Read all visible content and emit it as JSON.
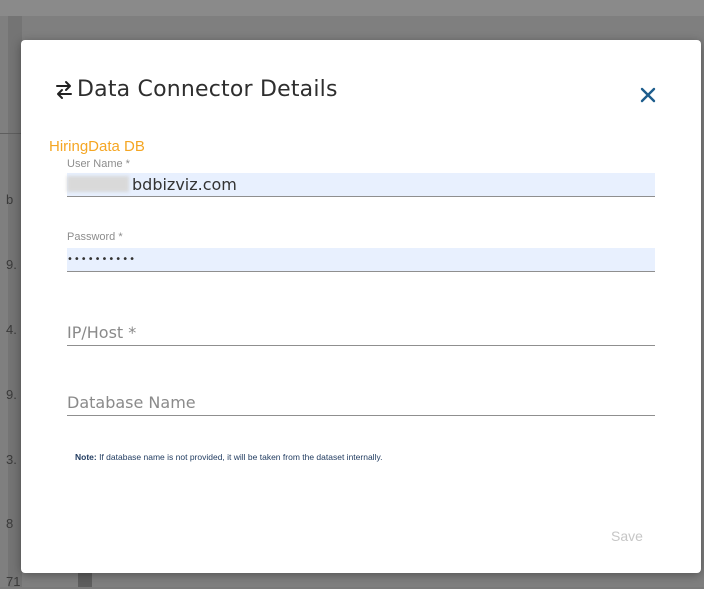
{
  "background": {
    "row_marks": [
      "b",
      "9.",
      "4.",
      "9.",
      "3.",
      "8",
      "71"
    ]
  },
  "modal": {
    "title": "Data Connector Details",
    "header_icon": "swap-arrows-icon",
    "close_icon": "close-icon",
    "section_label": "HiringData DB",
    "fields": {
      "username": {
        "label": "User Name *",
        "value": "bdbizviz.com"
      },
      "password": {
        "label": "Password *",
        "value": "••••••••••"
      },
      "host": {
        "placeholder": "IP/Host *",
        "value": ""
      },
      "database": {
        "placeholder": "Database Name",
        "value": ""
      }
    },
    "note_prefix": "Note:",
    "note_text": " If database name is not provided, it will be taken from the dataset internally.",
    "save_label": "Save"
  },
  "colors": {
    "accent_orange": "#f5a623",
    "close_blue": "#1d5d8c",
    "autofill_bg": "#e8f0fe"
  }
}
